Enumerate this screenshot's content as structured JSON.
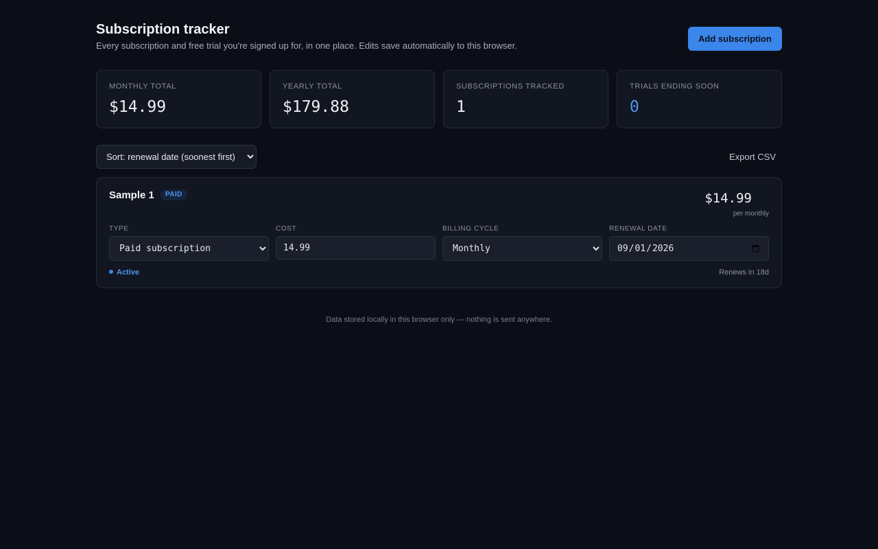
{
  "header": {
    "title": "Subscription tracker",
    "subtitle": "Every subscription and free trial you're signed up for, in one place. Edits save automatically to this browser.",
    "add_button": "Add subscription"
  },
  "stats": [
    {
      "label": "Monthly total",
      "value": "$14.99"
    },
    {
      "label": "Yearly total",
      "value": "$179.88"
    },
    {
      "label": "Subscriptions tracked",
      "value": "1"
    },
    {
      "label": "Trials ending soon",
      "value": "0"
    }
  ],
  "colors": {
    "accent": "#3b86ea",
    "background": "#0b0e16",
    "card": "#121620"
  },
  "toolbar": {
    "sort_selected": "Sort: renewal date (soonest first)",
    "export_label": "Export CSV"
  },
  "subscription": {
    "name": "Sample 1",
    "badge": "PAID",
    "price": "$14.99",
    "per": "per monthly",
    "fields": {
      "type": {
        "label": "Type",
        "value": "Paid subscription"
      },
      "cost": {
        "label": "Cost",
        "value": "14.99"
      },
      "cycle": {
        "label": "Billing cycle",
        "value": "Monthly"
      },
      "renewal": {
        "label": "Renewal date",
        "value": "2026-09-01"
      }
    },
    "status": "Active",
    "renews_in": "Renews in 18d"
  },
  "footer": "Data stored locally in this browser only — nothing is sent anywhere."
}
